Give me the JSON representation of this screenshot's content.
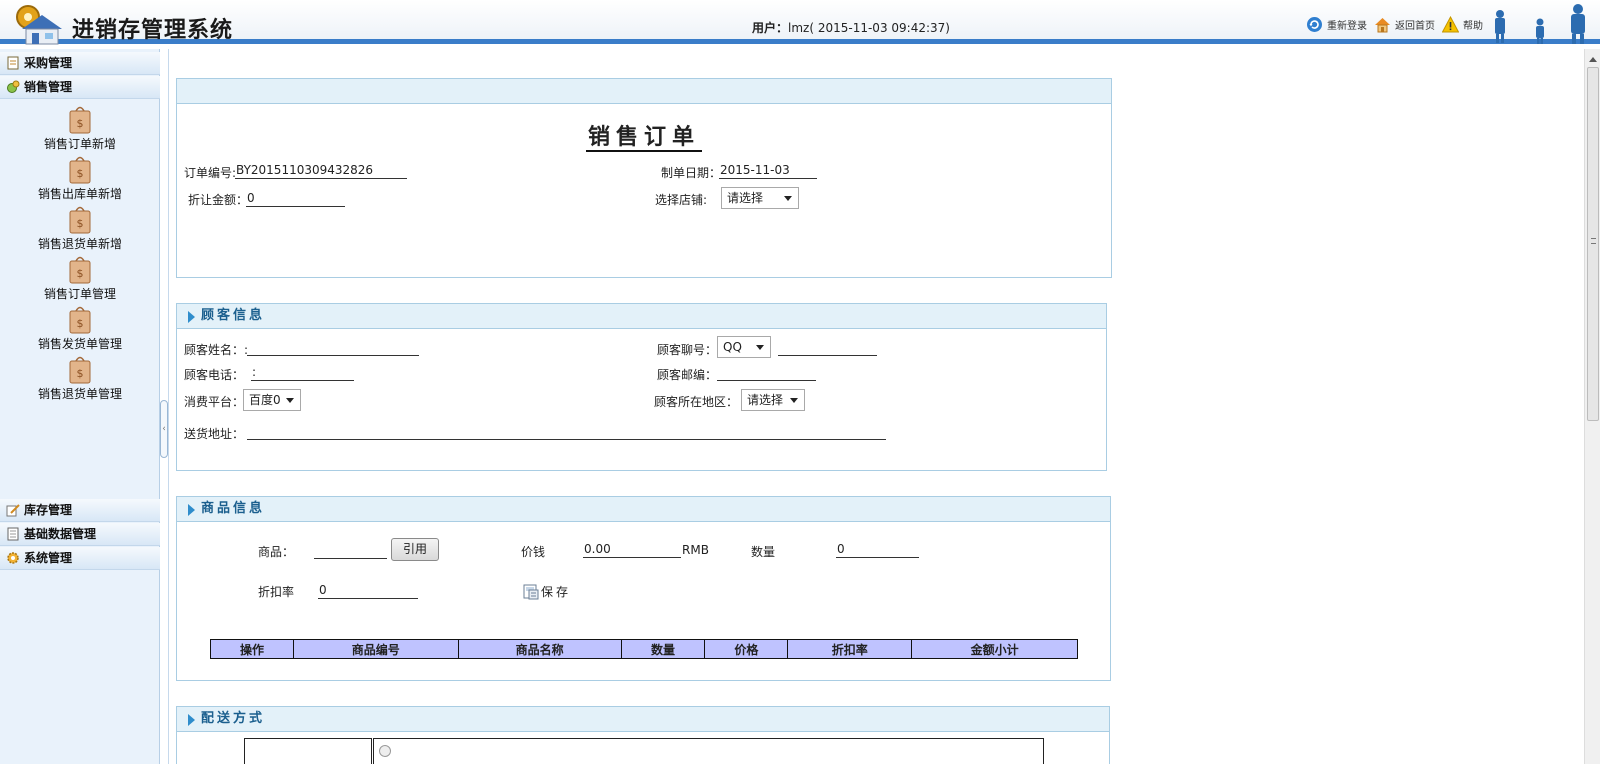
{
  "header": {
    "app_title": "进销存管理系统",
    "user_label": "用户：",
    "user_value": "lmz( 2015-11-03 09:42:37)",
    "links": [
      {
        "label": "重新登录",
        "icon": "refresh-icon"
      },
      {
        "label": "返回首页",
        "icon": "home-icon"
      },
      {
        "label": "帮助",
        "icon": "warning-icon"
      }
    ]
  },
  "sidebar": {
    "groups": [
      {
        "label": "采购管理",
        "icon": "notepad-icon"
      },
      {
        "label": "销售管理",
        "icon": "gear-leaf-icon"
      },
      {
        "label": "库存管理",
        "icon": "pencil-icon"
      },
      {
        "label": "基础数据管理",
        "icon": "document-icon"
      },
      {
        "label": "系统管理",
        "icon": "gear-icon"
      }
    ],
    "sales_items": [
      {
        "label": "销售订单新增"
      },
      {
        "label": "销售出库单新增"
      },
      {
        "label": "销售退货单新增"
      },
      {
        "label": "销售订单管理"
      },
      {
        "label": "销售发货单管理"
      },
      {
        "label": "销售退货单管理"
      }
    ]
  },
  "order": {
    "title": "销售订单",
    "order_no_label": "订单编号:",
    "order_no_value": "BY2015110309432826",
    "date_label": "制单日期：",
    "date_value": "2015-11-03",
    "discount_label": "折让金额：",
    "discount_value": "0",
    "store_label": "选择店铺:",
    "store_value": "请选择"
  },
  "customer": {
    "section_title": "顾客信息",
    "name_label": "顾客姓名：:",
    "chat_label": "顾客聊号：",
    "chat_type_value": "QQ",
    "phone_label": "顾客电话：",
    "phone_prefix": ":",
    "zip_label": "顾客邮编：",
    "platform_label": "消费平台：",
    "platform_value": "百度0",
    "region_label": "顾客所在地区：",
    "region_value": "请选择",
    "address_label": "送货地址："
  },
  "goods": {
    "section_title": "商品信息",
    "product_label": "商品：",
    "cite_button": "引用",
    "price_label": "价钱",
    "price_value": "0.00",
    "currency": "RMB",
    "qty_label": "数量",
    "qty_value": "0",
    "discount_rate_label": "折扣率",
    "discount_rate_value": "0",
    "save_label": "保存",
    "table_headers": [
      "操作",
      "商品编号",
      "商品名称",
      "数量",
      "价格",
      "折扣率",
      "金额小计"
    ]
  },
  "delivery": {
    "section_title": "配送方式"
  }
}
